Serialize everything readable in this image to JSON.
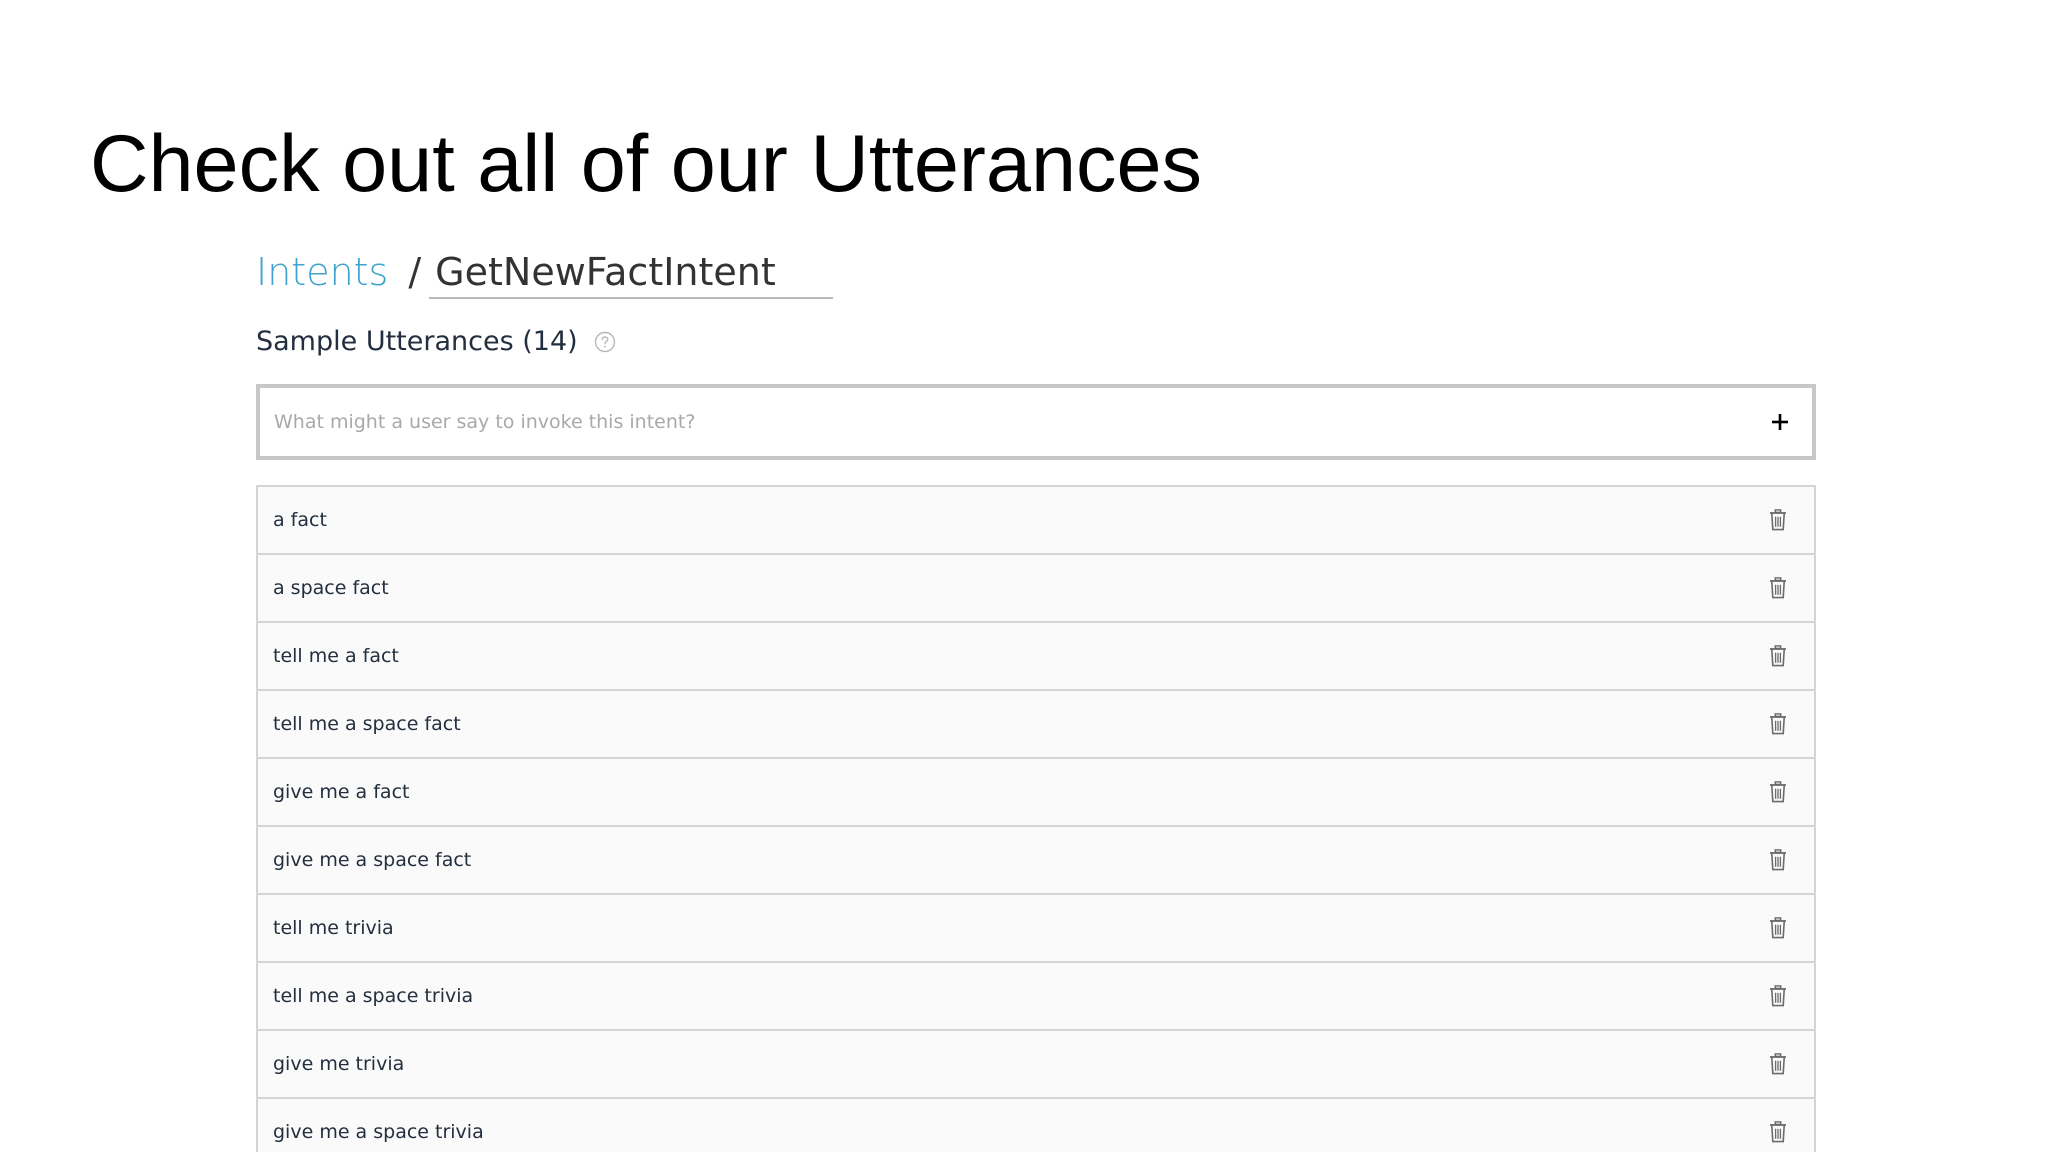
{
  "slide": {
    "title": "Check out all of our Utterances"
  },
  "breadcrumb": {
    "root_label": "Intents",
    "separator": "/",
    "current_label": "GetNewFactIntent"
  },
  "sample_utterances": {
    "heading": "Sample Utterances (14)",
    "help_icon": "question-circle-icon",
    "input": {
      "value": "",
      "placeholder": "What might a user say to invoke this intent?"
    },
    "add_icon": "plus-icon",
    "delete_icon": "trash-icon",
    "items": [
      "a fact",
      "a space fact",
      "tell me a fact",
      "tell me a space fact",
      "give me a fact",
      "give me a space fact",
      "tell me trivia",
      "tell me a space trivia",
      "give me trivia",
      "give me a space trivia"
    ]
  },
  "colors": {
    "link": "#3ea3cf",
    "text": "#232f3e",
    "border": "#d5d5d5",
    "row_background": "#fafafa"
  }
}
